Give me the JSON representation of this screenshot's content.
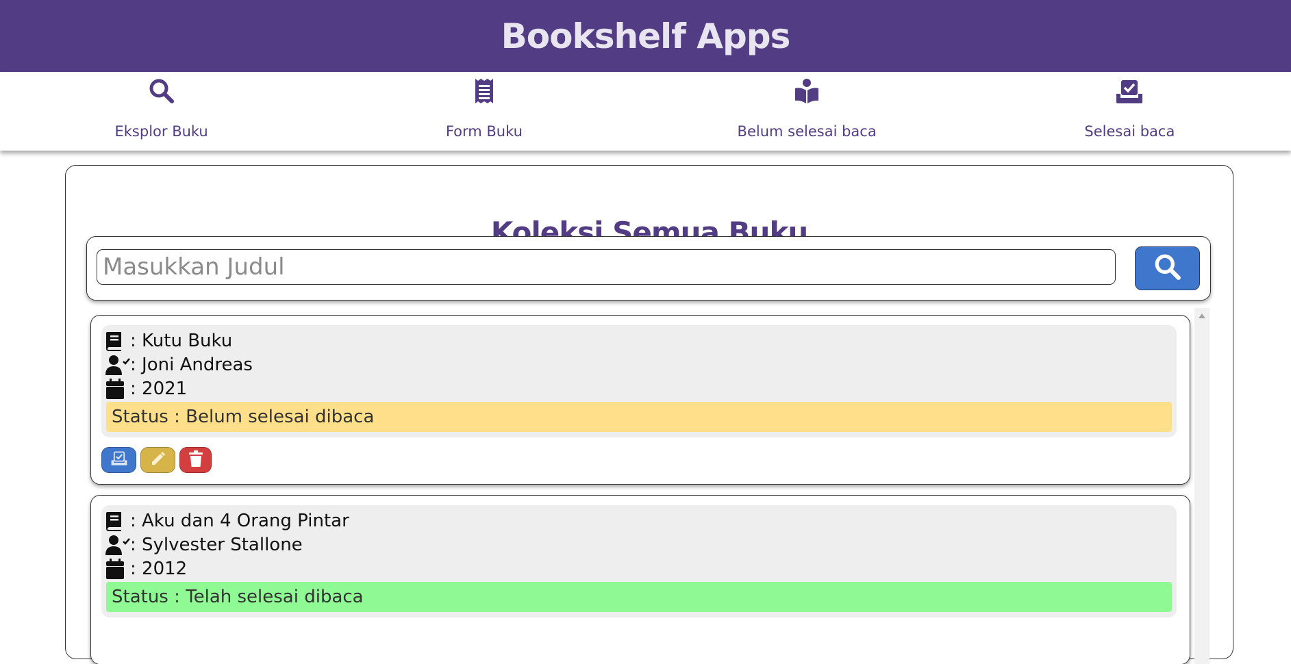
{
  "app": {
    "title": "Bookshelf Apps"
  },
  "nav": [
    {
      "label": "Eksplor Buku",
      "icon": "search-icon"
    },
    {
      "label": "Form Buku",
      "icon": "receipt-icon"
    },
    {
      "label": "Belum selesai baca",
      "icon": "book-reader-icon"
    },
    {
      "label": "Selesai baca",
      "icon": "inbox-check-icon"
    }
  ],
  "main": {
    "title": "Koleksi Semua Buku",
    "search": {
      "placeholder": "Masukkan Judul",
      "value": ""
    }
  },
  "books": [
    {
      "title": ": Kutu Buku",
      "author": ": Joni Andreas",
      "year": ": 2021",
      "status": "Status : Belum selesai dibaca",
      "status_color": "#ffdf8a"
    },
    {
      "title": ": Aku dan 4 Orang Pintar",
      "author": ": Sylvester Stallone",
      "year": ": 2012",
      "status": "Status : Telah selesai dibaca",
      "status_color": "#8ff993"
    }
  ],
  "colors": {
    "brand": "#523c84",
    "search_button": "#3f77cc",
    "finish_button": "#3f77cc",
    "edit_button": "#d6b44a",
    "delete_button": "#d33f3f"
  }
}
